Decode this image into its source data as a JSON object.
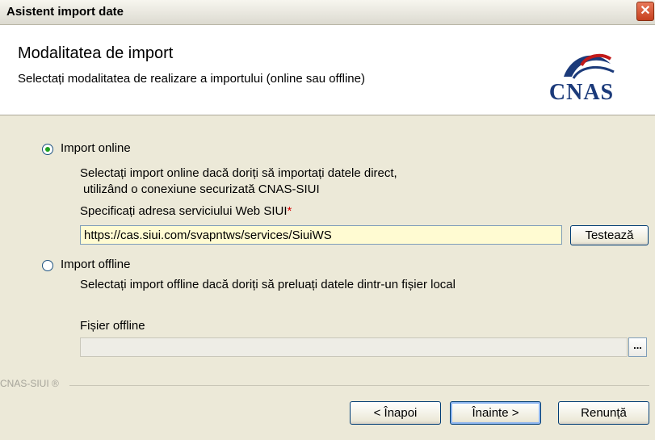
{
  "window": {
    "title": "Asistent import date",
    "close_glyph": "✕"
  },
  "header": {
    "title": "Modalitatea de import",
    "subtitle": "Selectați modalitatea de realizare a importului (online sau offline)",
    "logo_text": "CNAS",
    "logo_color": "#1b3a7a"
  },
  "online": {
    "label": "Import online",
    "selected": true,
    "desc_line1": "Selectați import online dacă doriți să importați datele direct,",
    "desc_line2": "utilizând o conexiune securizată CNAS-SIUI",
    "url_label": "Specificați adresa serviciului Web SIUI",
    "required_mark": "*",
    "url_value": "https://cas.siui.com/svapntws/services/SiuiWS",
    "test_button": "Testează"
  },
  "offline": {
    "label": "Import offline",
    "selected": false,
    "desc": "Selectați import offline dacă doriți să preluați datele dintr-un fișier local",
    "file_label": "Fișier offline",
    "file_value": "",
    "browse_button": "..."
  },
  "footer": {
    "brand": "CNAS-SIUI ®",
    "back_button": "< Înapoi",
    "next_button": "Înainte >",
    "cancel_button": "Renunță"
  },
  "colors": {
    "input_highlight": "#fffbd2",
    "accent_red": "#d40000",
    "radio_dot": "#21a121"
  }
}
